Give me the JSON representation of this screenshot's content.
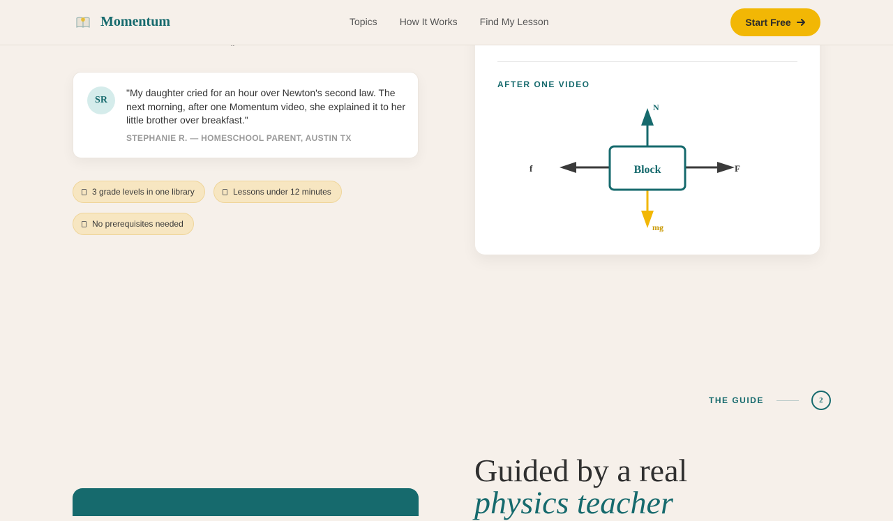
{
  "nav": {
    "logo_text": "Momentum",
    "links": [
      "Topics",
      "How It Works",
      "Find My Lesson"
    ],
    "cta_label": "Start Free"
  },
  "testimonial": {
    "initials": "SR",
    "quote": "\"My daughter cried for an hour over Newton's second law. The next morning, after one Momentum video, she explained it to her little brother over breakfast.\"",
    "attribution": "STEPHANIE R. — HOMESCHOOL PARENT, AUSTIN TX"
  },
  "chips": [
    "3 grade levels in one library",
    "Lessons under 12 minutes",
    "No prerequisites needed"
  ],
  "diagram": {
    "label": "AFTER ONE VIDEO",
    "block": "Block",
    "forces": {
      "up": "N",
      "down": "mg",
      "left": "f",
      "right": "F"
    },
    "colors": {
      "teal": "#166a6d",
      "gold": "#f2b705",
      "dark": "#3a3a3a"
    }
  },
  "section": {
    "label": "THE GUIDE",
    "number": "2",
    "headline_line1": "Guided by a real",
    "headline_line2": "physics teacher"
  },
  "sliver": "y"
}
